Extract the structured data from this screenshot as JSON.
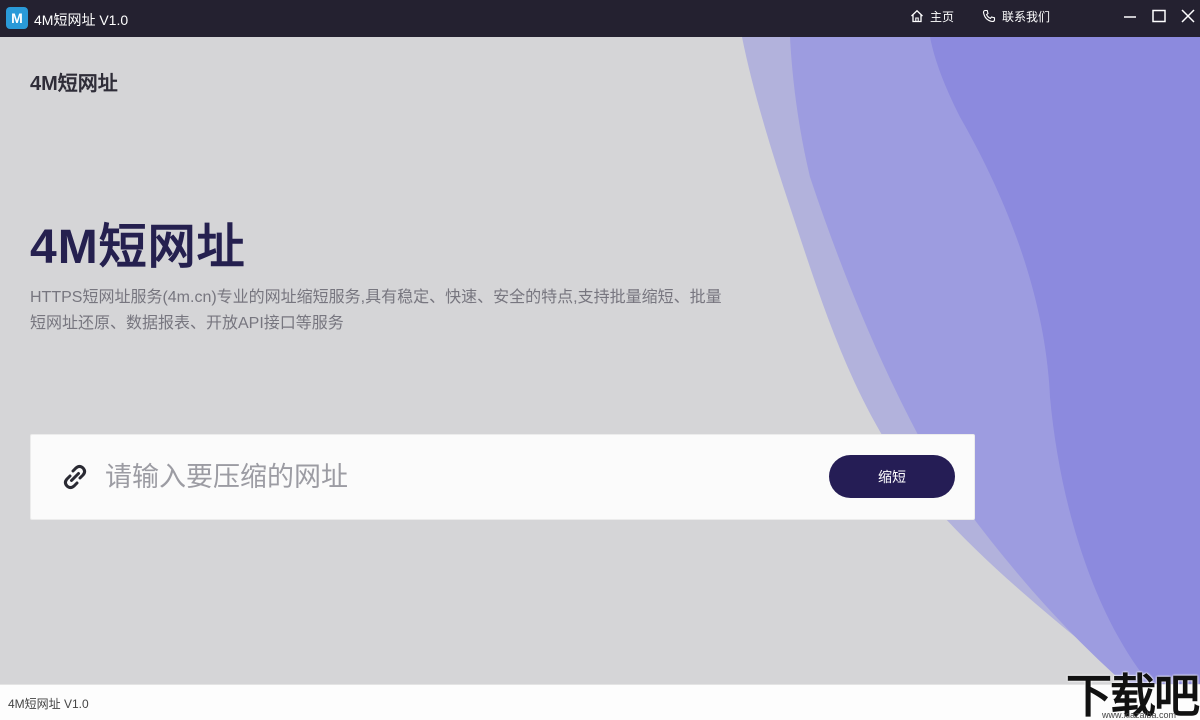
{
  "window": {
    "title": "4M短网址  V1.0",
    "logo_letter": "M",
    "nav": [
      {
        "label": "主页",
        "icon": "home-icon"
      },
      {
        "label": "联系我们",
        "icon": "phone-icon"
      }
    ]
  },
  "main": {
    "brand": "4M短网址",
    "hero_title": "4M短网址",
    "description": "HTTPS短网址服务(4m.cn)专业的网址缩短服务,具有稳定、快速、安全的特点,支持批量缩短、批量短网址还原、数据报表、开放API接口等服务",
    "input": {
      "placeholder": "请输入要压缩的网址",
      "value": ""
    },
    "shorten_label": "缩短"
  },
  "footer": {
    "text": "4M短网址  V1.0"
  },
  "watermark": {
    "main": "下载吧",
    "sub": "www.xiazaiba.com"
  },
  "colors": {
    "titlebar": "#242130",
    "background": "#d5d5d7",
    "accent": "#251d55",
    "wave_light": "#b2b2dc",
    "wave_mid": "#9d9ce0",
    "wave_dark": "#8c8ade"
  }
}
